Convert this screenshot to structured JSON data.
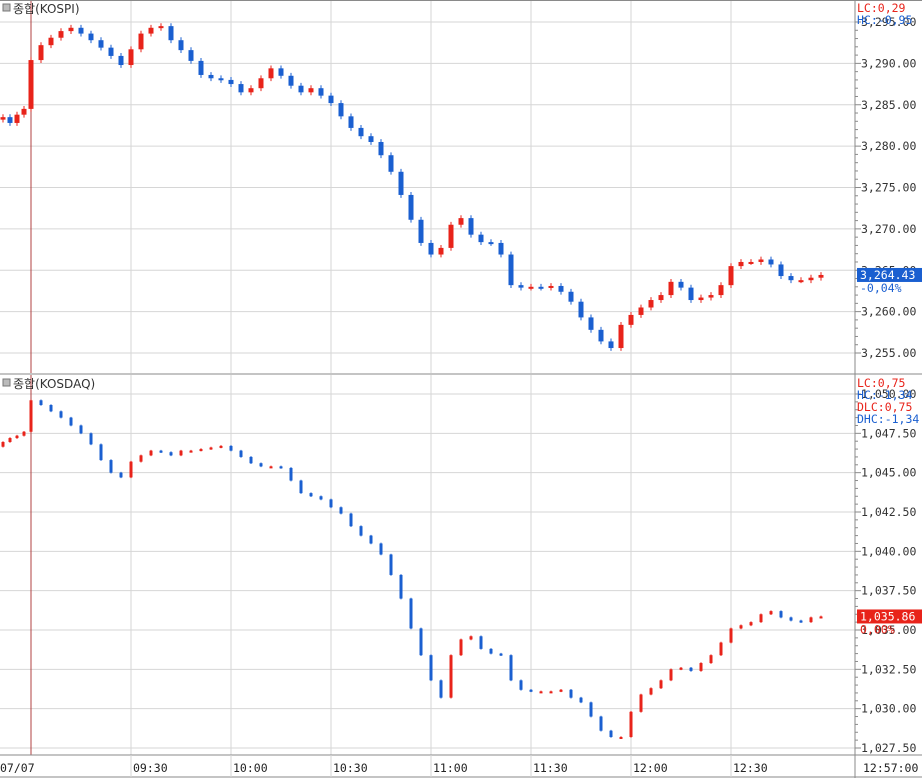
{
  "colors": {
    "up": "#e8231a",
    "down": "#1a5fd0",
    "grid": "#d6d6d6",
    "frame": "#8a8a8a",
    "axis_text": "#333333"
  },
  "time_axis": {
    "date_label": "07/07",
    "ticks": [
      "09:30",
      "10:00",
      "10:30",
      "11:00",
      "11:30",
      "12:00",
      "12:30"
    ],
    "current_time": "12:57:00"
  },
  "chart_data": [
    {
      "type": "candlestick",
      "title": "종합(KOSPI)",
      "ylim": [
        3252.5,
        3295
      ],
      "yticks": [
        "3,295.00",
        "3,290.00",
        "3,285.00",
        "3,280.00",
        "3,275.00",
        "3,270.00",
        "3,265.00",
        "3,260.00",
        "3,255.00"
      ],
      "ytick_values": [
        3295,
        3290,
        3285,
        3280,
        3275,
        3270,
        3265,
        3260,
        3255
      ],
      "info": [
        {
          "text": "LC:0,29",
          "color": "#e8231a"
        },
        {
          "text": "HC:-0,95",
          "color": "#1a5fd0"
        }
      ],
      "last_value": "3,264.43",
      "last_change": "-0,04%",
      "last_color": "#1a5fd0",
      "prior_session_close": [
        3283.5,
        3282.8,
        3283.8,
        3284.5
      ],
      "x": [
        "09:00",
        "09:03",
        "09:06",
        "09:09",
        "09:12",
        "09:15",
        "09:18",
        "09:21",
        "09:24",
        "09:27",
        "09:30",
        "09:33",
        "09:36",
        "09:39",
        "09:42",
        "09:45",
        "09:48",
        "09:51",
        "09:54",
        "09:57",
        "10:00",
        "10:03",
        "10:06",
        "10:09",
        "10:12",
        "10:15",
        "10:18",
        "10:21",
        "10:24",
        "10:27",
        "10:30",
        "10:33",
        "10:36",
        "10:39",
        "10:42",
        "10:45",
        "10:48",
        "10:51",
        "10:54",
        "10:57",
        "11:00",
        "11:03",
        "11:06",
        "11:09",
        "11:12",
        "11:15",
        "11:18",
        "11:21",
        "11:24",
        "11:27",
        "11:30",
        "11:33",
        "11:36",
        "11:39",
        "11:42",
        "11:45",
        "11:48",
        "11:51",
        "11:54",
        "11:57",
        "12:00",
        "12:03",
        "12:06",
        "12:09",
        "12:12",
        "12:15",
        "12:18",
        "12:21",
        "12:24",
        "12:27",
        "12:30",
        "12:33",
        "12:36",
        "12:39",
        "12:42",
        "12:45",
        "12:48",
        "12:51",
        "12:54",
        "12:57"
      ],
      "close": [
        3290.4,
        3292.2,
        3293.1,
        3293.9,
        3294.3,
        3293.6,
        3292.8,
        3291.9,
        3290.9,
        3289.8,
        3291.7,
        3293.6,
        3294.3,
        3294.5,
        3292.8,
        3291.6,
        3290.3,
        3288.6,
        3288.2,
        3288.0,
        3287.5,
        3286.5,
        3287.0,
        3288.2,
        3289.4,
        3288.5,
        3287.3,
        3286.5,
        3287.0,
        3286.1,
        3285.2,
        3283.6,
        3282.2,
        3281.2,
        3280.5,
        3278.9,
        3276.9,
        3274.1,
        3271.1,
        3268.3,
        3266.9,
        3267.7,
        3270.5,
        3271.3,
        3269.3,
        3268.4,
        3268.3,
        3266.9,
        3263.2,
        3262.9,
        3263.0,
        3262.9,
        3263.1,
        3262.4,
        3261.2,
        3259.3,
        3257.8,
        3256.4,
        3255.6,
        3258.4,
        3259.6,
        3260.5,
        3261.4,
        3262.0,
        3263.6,
        3262.9,
        3261.4,
        3261.7,
        3262.0,
        3263.2,
        3265.5,
        3266.0,
        3266.0,
        3266.3,
        3265.7,
        3264.3,
        3263.8,
        3263.8,
        3264.1,
        3264.43
      ]
    },
    {
      "type": "candlestick",
      "title": "종합(KOSDAQ)",
      "ylim": [
        1026.5,
        1050
      ],
      "yticks": [
        "1,050.00",
        "1,047.50",
        "1,045.00",
        "1,042.50",
        "1,040.00",
        "1,037.50",
        "1,035.00",
        "1,032.50",
        "1,030.00",
        "1,027.50"
      ],
      "ytick_values": [
        1050,
        1047.5,
        1045,
        1042.5,
        1040,
        1037.5,
        1035,
        1032.5,
        1030,
        1027.5
      ],
      "info": [
        {
          "text": "LC:0,75",
          "color": "#e8231a"
        },
        {
          "text": "HC:-1,34",
          "color": "#1a5fd0"
        },
        {
          "text": "DLC:0,75",
          "color": "#e8231a"
        },
        {
          "text": "DHC:-1,34",
          "color": "#1a5fd0"
        }
      ],
      "last_value": "1,035.86",
      "last_change": "0,00%",
      "last_color": "#e8231a",
      "prior_session_close": [
        1046.95,
        1047.2,
        1047.35,
        1047.6
      ],
      "x": [
        "09:00",
        "09:03",
        "09:06",
        "09:09",
        "09:12",
        "09:15",
        "09:18",
        "09:21",
        "09:24",
        "09:27",
        "09:30",
        "09:33",
        "09:36",
        "09:39",
        "09:42",
        "09:45",
        "09:48",
        "09:51",
        "09:54",
        "09:57",
        "10:00",
        "10:03",
        "10:06",
        "10:09",
        "10:12",
        "10:15",
        "10:18",
        "10:21",
        "10:24",
        "10:27",
        "10:30",
        "10:33",
        "10:36",
        "10:39",
        "10:42",
        "10:45",
        "10:48",
        "10:51",
        "10:54",
        "10:57",
        "11:00",
        "11:03",
        "11:06",
        "11:09",
        "11:12",
        "11:15",
        "11:18",
        "11:21",
        "11:24",
        "11:27",
        "11:30",
        "11:33",
        "11:36",
        "11:39",
        "11:42",
        "11:45",
        "11:48",
        "11:51",
        "11:54",
        "11:57",
        "12:00",
        "12:03",
        "12:06",
        "12:09",
        "12:12",
        "12:15",
        "12:18",
        "12:21",
        "12:24",
        "12:27",
        "12:30",
        "12:33",
        "12:36",
        "12:39",
        "12:42",
        "12:45",
        "12:48",
        "12:51",
        "12:54",
        "12:57"
      ],
      "close": [
        1049.6,
        1049.3,
        1048.9,
        1048.5,
        1048.0,
        1047.5,
        1046.8,
        1045.8,
        1045.0,
        1044.7,
        1045.7,
        1046.1,
        1046.4,
        1046.3,
        1046.1,
        1046.4,
        1046.4,
        1046.5,
        1046.6,
        1046.7,
        1046.4,
        1046.0,
        1045.6,
        1045.4,
        1045.4,
        1045.3,
        1044.5,
        1043.7,
        1043.5,
        1043.3,
        1042.8,
        1042.4,
        1041.6,
        1041.0,
        1040.5,
        1039.8,
        1038.5,
        1037.0,
        1035.1,
        1033.4,
        1031.8,
        1030.7,
        1033.4,
        1034.4,
        1034.6,
        1033.8,
        1033.5,
        1033.4,
        1031.8,
        1031.2,
        1031.1,
        1031.1,
        1031.1,
        1031.2,
        1030.7,
        1030.4,
        1029.5,
        1028.6,
        1028.2,
        1028.2,
        1029.8,
        1030.9,
        1031.3,
        1031.8,
        1032.5,
        1032.6,
        1032.4,
        1032.9,
        1033.4,
        1034.2,
        1035.1,
        1035.3,
        1035.5,
        1036.0,
        1036.2,
        1035.8,
        1035.6,
        1035.5,
        1035.8,
        1035.86
      ]
    }
  ]
}
